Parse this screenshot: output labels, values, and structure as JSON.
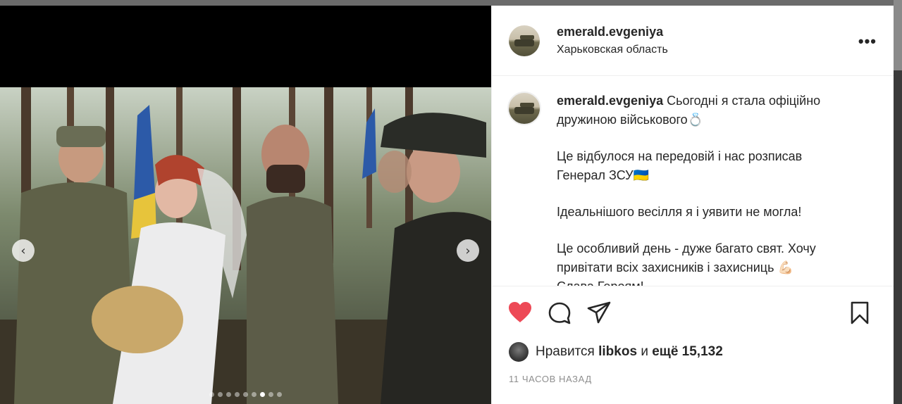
{
  "post": {
    "username": "emerald.evgeniya",
    "location": "Харьковская область",
    "caption_paragraphs": [
      "Сьогодні я стала офіційно дружиною військового💍",
      "Це відбулося на передовій і нас розписав Генерал ЗСУ🇺🇦",
      "Ідеальнішого весілля я і уявити не могла!",
      "Це особливий день - дуже багато свят. Хочу привітати всіх захисників і захисниць 💪🏻",
      "Слава Героям!"
    ],
    "likes_prefix": "Нравится",
    "liked_by": "libkos",
    "likes_conjunction": "и",
    "likes_more": "ещё 15,132",
    "timestamp": "11 часов назад"
  },
  "carousel": {
    "slide_count": 9,
    "active_index": 6,
    "prev_icon": "chevron-left-icon",
    "next_icon": "chevron-right-icon"
  },
  "icons": {
    "more": "more-horizontal-icon",
    "like": "heart-filled-icon",
    "comment": "comment-icon",
    "share": "send-icon",
    "save": "bookmark-icon"
  },
  "colors": {
    "like_red": "#ed4956",
    "text": "#262626",
    "muted": "#8e8e8e"
  }
}
